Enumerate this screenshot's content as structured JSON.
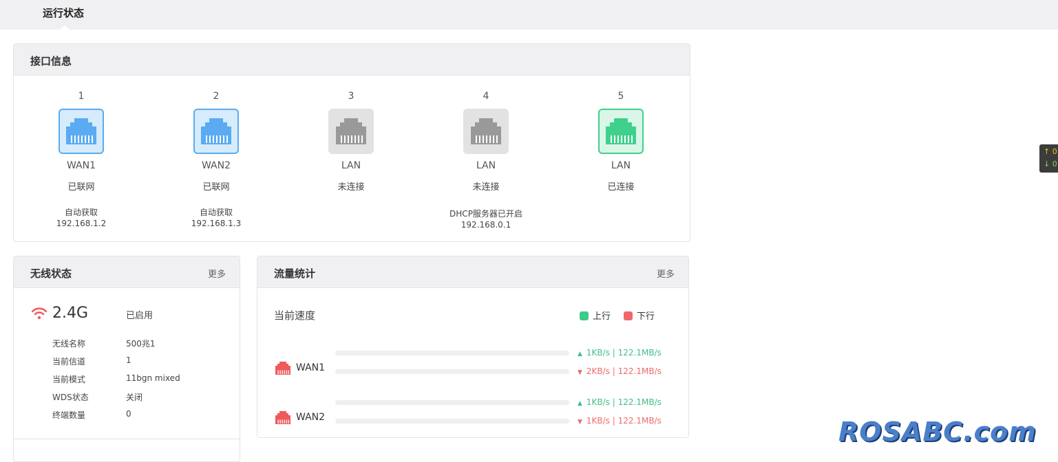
{
  "topbar": {
    "tab_label": "运行状态"
  },
  "interface_panel": {
    "title": "接口信息",
    "ports": [
      {
        "num": "1",
        "name": "WAN1",
        "status": "已联网",
        "mode": "自动获取",
        "ip": "192.168.1.2",
        "state": "blue"
      },
      {
        "num": "2",
        "name": "WAN2",
        "status": "已联网",
        "mode": "自动获取",
        "ip": "192.168.1.3",
        "state": "blue"
      },
      {
        "num": "3",
        "name": "LAN",
        "status": "未连接",
        "mode": "",
        "ip": "",
        "state": "gray"
      },
      {
        "num": "4",
        "name": "LAN",
        "status": "未连接",
        "mode": "DHCP服务器已开启",
        "ip": "192.168.0.1",
        "state": "gray"
      },
      {
        "num": "5",
        "name": "LAN",
        "status": "已连接",
        "mode": "",
        "ip": "",
        "state": "green"
      }
    ],
    "colors": {
      "blue": "#5aabf2",
      "gray": "#999999",
      "green": "#3fd08c"
    }
  },
  "wireless_panel": {
    "title": "无线状态",
    "more_label": "更多",
    "band": "2.4G",
    "state": "已启用",
    "rows": [
      {
        "label": "无线名称",
        "value": "500兆1"
      },
      {
        "label": "当前信道",
        "value": "1"
      },
      {
        "label": "当前模式",
        "value": "11bgn mixed"
      },
      {
        "label": "WDS状态",
        "value": "关闭"
      },
      {
        "label": "终端数量",
        "value": "0"
      }
    ],
    "icon_color": "#ee5a5a"
  },
  "traffic_panel": {
    "title": "流量统计",
    "more_label": "更多",
    "speed_label": "当前速度",
    "legend": {
      "up_label": "上行",
      "down_label": "下行",
      "up_color": "#3fc98a",
      "down_color": "#ee6a6a"
    },
    "wans": [
      {
        "name": "WAN1",
        "up": "1KB/s | 122.1MB/s",
        "down": "2KB/s | 122.1MB/s"
      },
      {
        "name": "WAN2",
        "up": "1KB/s | 122.1MB/s",
        "down": "1KB/s | 122.1MB/s"
      }
    ]
  },
  "float_widget": {
    "up": "↑ 0",
    "down": "↓ 0"
  },
  "watermark": "ROSABC.com"
}
